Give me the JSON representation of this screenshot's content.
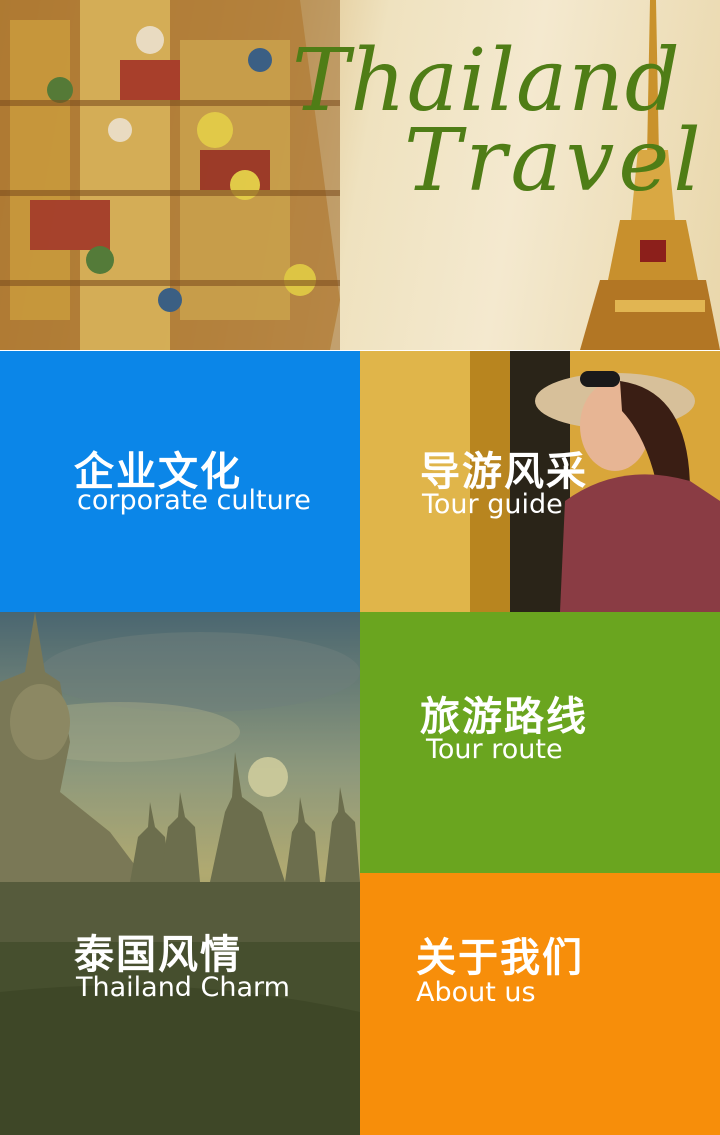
{
  "hero": {
    "title_line1": "Thailand",
    "title_line2": "Travel"
  },
  "tiles": [
    {
      "zh": "企业文化",
      "en": "corporate culture",
      "color": "#0b86e8"
    },
    {
      "zh": "导游风采",
      "en": "Tour guide",
      "color": "#d8a53a"
    },
    {
      "zh": "泰国风情",
      "en": "Thailand Charm",
      "color": "#5c6a3e"
    },
    {
      "zh": "旅游路线",
      "en": "Tour route",
      "color": "#6aa51f"
    },
    {
      "zh": "关于我们",
      "en": "About us",
      "color": "#f78e0a"
    }
  ],
  "colors": {
    "title_green": "#4f7d16"
  }
}
